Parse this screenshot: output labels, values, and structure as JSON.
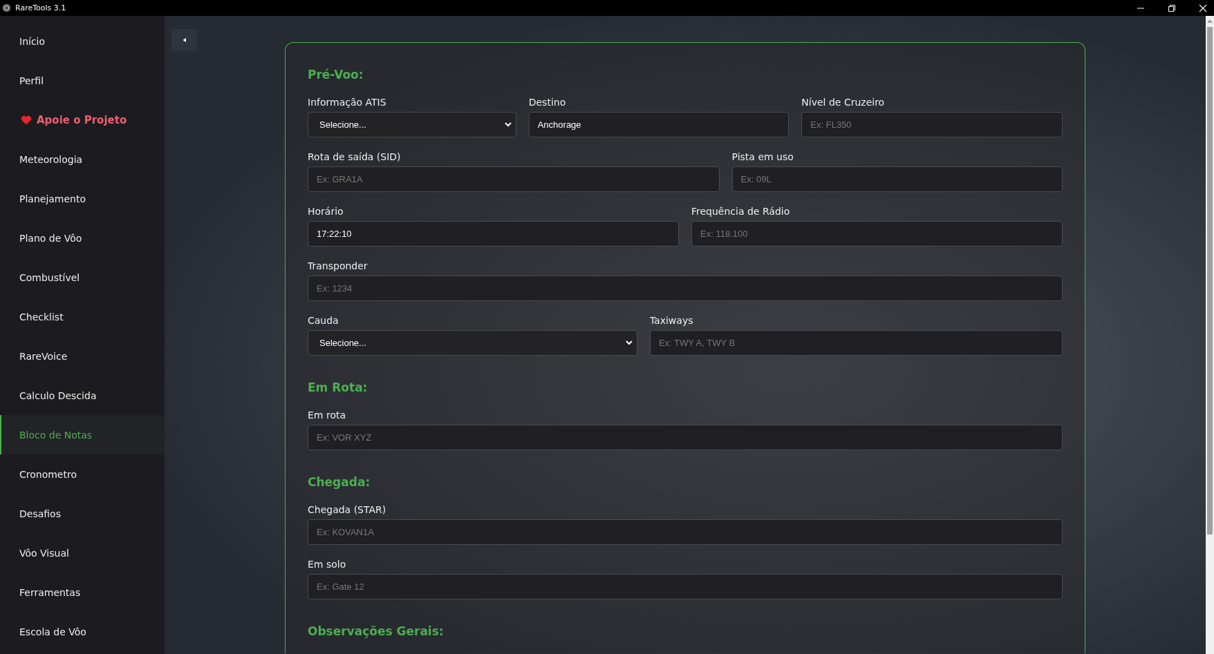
{
  "window": {
    "title": "RareTools 3.1"
  },
  "sidebar": {
    "items": [
      {
        "label": "Início",
        "kind": "link",
        "selected": false
      },
      {
        "label": "Perfil",
        "kind": "link",
        "selected": false
      },
      {
        "label": "Apoie o Projeto",
        "kind": "support",
        "selected": false
      },
      {
        "label": "Meteorologia",
        "kind": "link",
        "selected": false
      },
      {
        "label": "Planejamento",
        "kind": "link",
        "selected": false
      },
      {
        "label": "Plano de Vôo",
        "kind": "link",
        "selected": false
      },
      {
        "label": "Combustível",
        "kind": "link",
        "selected": false
      },
      {
        "label": "Checklist",
        "kind": "link",
        "selected": false
      },
      {
        "label": "RareVoice",
        "kind": "link",
        "selected": false
      },
      {
        "label": "Calculo Descida",
        "kind": "link",
        "selected": false
      },
      {
        "label": "Bloco de Notas",
        "kind": "link",
        "selected": true
      },
      {
        "label": "Cronometro",
        "kind": "link",
        "selected": false
      },
      {
        "label": "Desafios",
        "kind": "link",
        "selected": false
      },
      {
        "label": "Vôo Visual",
        "kind": "link",
        "selected": false
      },
      {
        "label": "Ferramentas",
        "kind": "link",
        "selected": false
      },
      {
        "label": "Escola de Vôo",
        "kind": "link",
        "selected": false
      }
    ]
  },
  "form": {
    "sections": [
      {
        "heading": "Pré-Voo:",
        "rows": [
          [
            {
              "label": "Informação ATIS",
              "kind": "select",
              "value": "Selecione..."
            },
            {
              "label": "Destino",
              "kind": "text",
              "value": "Anchorage"
            },
            {
              "label": "Nível de Cruzeiro",
              "kind": "text",
              "placeholder": "Ex: FL350"
            }
          ],
          [
            {
              "label": "Rota de saída (SID)",
              "kind": "text",
              "placeholder": "Ex: GRA1A"
            },
            {
              "label": "Pista em uso",
              "kind": "text",
              "placeholder": "Ex: 09L"
            }
          ],
          [
            {
              "label": "Horário",
              "kind": "text",
              "value": "17:22:10"
            },
            {
              "label": "Frequência de Rádio",
              "kind": "text",
              "placeholder": "Ex: 118.100"
            }
          ],
          [
            {
              "label": "Transponder",
              "kind": "text",
              "placeholder": "Ex: 1234"
            }
          ],
          [
            {
              "label": "Cauda",
              "kind": "select",
              "value": "Selecione..."
            },
            {
              "label": "Taxiways",
              "kind": "text",
              "placeholder": "Ex: TWY A, TWY B"
            }
          ]
        ]
      },
      {
        "heading": "Em Rota:",
        "rows": [
          [
            {
              "label": "Em rota",
              "kind": "text",
              "placeholder": "Ex: VOR XYZ"
            }
          ]
        ]
      },
      {
        "heading": "Chegada:",
        "rows": [
          [
            {
              "label": "Chegada (STAR)",
              "kind": "text",
              "placeholder": "Ex: KOVAN1A"
            }
          ],
          [
            {
              "label": "Em solo",
              "kind": "text",
              "placeholder": "Ex: Gate 12"
            }
          ]
        ]
      },
      {
        "heading": "Observações Gerais:"
      }
    ]
  }
}
